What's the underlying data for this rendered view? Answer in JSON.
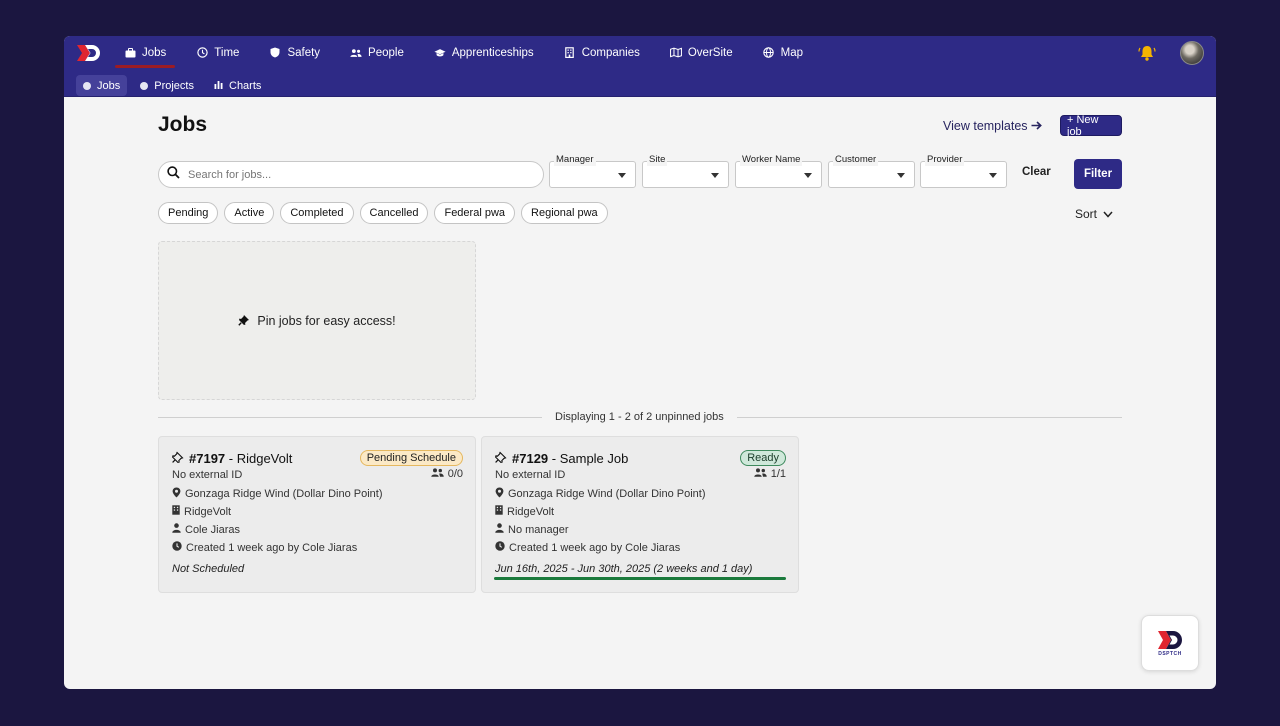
{
  "nav": {
    "items": [
      {
        "label": "Jobs",
        "icon": "briefcase-icon",
        "active": true
      },
      {
        "label": "Time",
        "icon": "clock-icon",
        "active": false
      },
      {
        "label": "Safety",
        "icon": "shield-icon",
        "active": false
      },
      {
        "label": "People",
        "icon": "users-icon",
        "active": false
      },
      {
        "label": "Apprenticeships",
        "icon": "graduation-cap-icon",
        "active": false
      },
      {
        "label": "Companies",
        "icon": "building-icon",
        "active": false
      },
      {
        "label": "OverSite",
        "icon": "map-book-icon",
        "active": false
      },
      {
        "label": "Map",
        "icon": "globe-icon",
        "active": false
      }
    ]
  },
  "subnav": {
    "items": [
      {
        "label": "Jobs",
        "icon": "dot-icon",
        "active": true
      },
      {
        "label": "Projects",
        "icon": "dot-icon",
        "active": false
      },
      {
        "label": "Charts",
        "icon": "bar-chart-icon",
        "active": false
      }
    ]
  },
  "page": {
    "title": "Jobs",
    "view_templates": "View templates",
    "new_job": "+ New job"
  },
  "filters": {
    "search_placeholder": "Search for jobs...",
    "selects": [
      "Manager",
      "Site",
      "Worker Name",
      "Customer",
      "Provider"
    ],
    "clear": "Clear",
    "filter": "Filter"
  },
  "chips": [
    "Pending",
    "Active",
    "Completed",
    "Cancelled",
    "Federal pwa",
    "Regional pwa"
  ],
  "sort": "Sort",
  "pinned": {
    "empty_text": "Pin jobs for easy access!"
  },
  "listing": {
    "summary": "Displaying 1 - 2 of 2 unpinned jobs"
  },
  "jobs": [
    {
      "number": "#7197",
      "name": " - RidgeVolt",
      "status": "Pending Schedule",
      "external_id": "No external ID",
      "workers": "0/0",
      "site": "Gonzaga Ridge Wind (Dollar Dino Point)",
      "company": "RidgeVolt",
      "manager": "Cole Jiaras",
      "created": "Created 1 week ago by Cole Jiaras",
      "schedule": "Not Scheduled"
    },
    {
      "number": "#7129",
      "name": " - Sample Job",
      "status": "Ready",
      "external_id": "No external ID",
      "workers": "1/1",
      "site": "Gonzaga Ridge Wind (Dollar Dino Point)",
      "company": "RidgeVolt",
      "manager": "No manager",
      "created": "Created 1 week ago by Cole Jiaras",
      "schedule": "Jun 16th, 2025 - Jun 30th, 2025 (2 weeks and 1 day)"
    }
  ],
  "corner_logo": {
    "text": "DSPTCH"
  },
  "colors": {
    "brand": "#2e2a86",
    "accent_red": "#9b1c24",
    "ready": "#1b7a3c",
    "pending": "#fbe9c6"
  }
}
